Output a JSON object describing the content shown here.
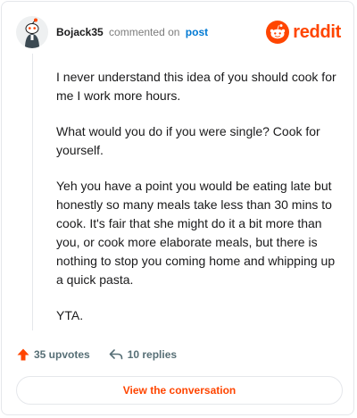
{
  "comment": {
    "author": "Bojack35",
    "action_text": "commented on",
    "post_link_text": "post",
    "paragraphs": [
      "I never understand this idea of you should cook for me I work more hours.",
      "What would you do if you were single? Cook for yourself.",
      "Yeh you have a point you would be eating late but honestly so many meals take less than 30 mins to cook. It's fair that she might do it a bit more than you, or cook more elaborate meals, but there is nothing to stop you coming home and whipping up a quick pasta.",
      "YTA."
    ]
  },
  "brand": {
    "wordmark": "reddit",
    "color": "#ff4500",
    "icon": "reddit-snoo-icon"
  },
  "footer": {
    "upvotes_label": "35 upvotes",
    "replies_label": "10 replies",
    "upvote_icon": "upvote-arrow-icon",
    "reply_icon": "reply-arrow-icon",
    "upvote_color": "#ff4500"
  },
  "cta": {
    "label": "View the conversation"
  },
  "colors": {
    "link_blue": "#0079d3",
    "muted_text": "#576f76",
    "border": "#e5e7eb"
  }
}
